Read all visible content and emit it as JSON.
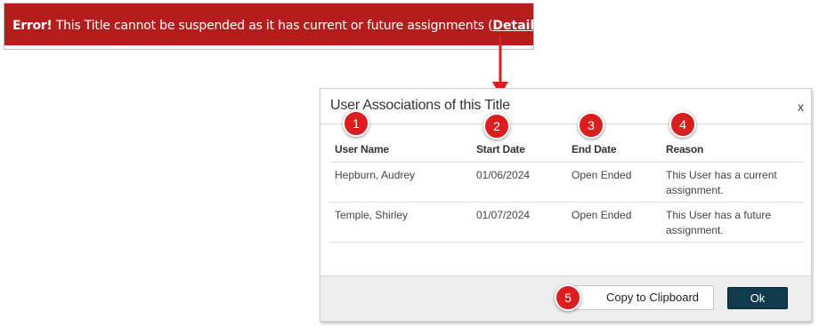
{
  "error_banner": {
    "prefix": "Error!",
    "message": " This Title cannot be suspended as it has current or future assignments (",
    "details_link": "Details",
    "suffix": ")."
  },
  "modal": {
    "title": "User Associations of this Title",
    "close_label": "x",
    "columns": [
      "User Name",
      "Start Date",
      "End Date",
      "Reason"
    ],
    "rows": [
      {
        "user_name": "Hepburn, Audrey",
        "start_date": "01/06/2024",
        "end_date": "Open Ended",
        "reason": "This User has a current assignment."
      },
      {
        "user_name": "Temple, Shirley",
        "start_date": "01/07/2024",
        "end_date": "Open Ended",
        "reason": "This User has a future assignment."
      }
    ],
    "copy_button": "Copy to Clipboard",
    "ok_button": "Ok"
  },
  "callouts": [
    "1",
    "2",
    "3",
    "4",
    "5"
  ],
  "colors": {
    "error_red": "#b51d1d",
    "marker_red": "#d91f1f",
    "ok_button": "#123a4d"
  }
}
